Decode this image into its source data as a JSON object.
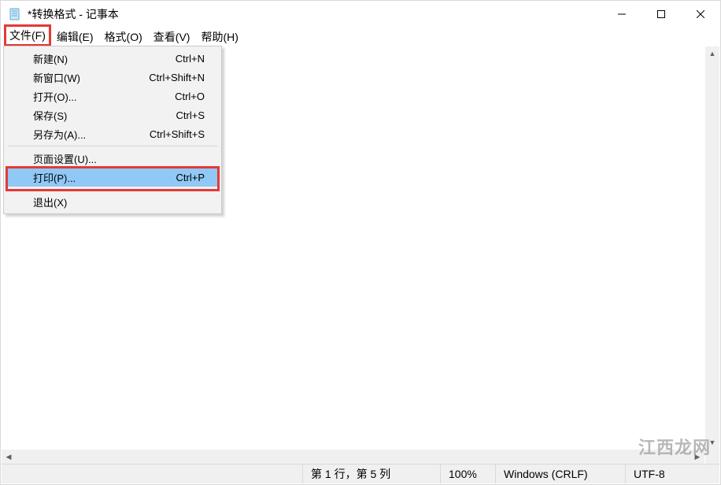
{
  "title": "*转换格式 - 记事本",
  "menubar": {
    "file": "文件(F)",
    "edit": "编辑(E)",
    "format": "格式(O)",
    "view": "查看(V)",
    "help": "帮助(H)"
  },
  "file_menu": {
    "new": {
      "label": "新建(N)",
      "shortcut": "Ctrl+N"
    },
    "new_window": {
      "label": "新窗口(W)",
      "shortcut": "Ctrl+Shift+N"
    },
    "open": {
      "label": "打开(O)...",
      "shortcut": "Ctrl+O"
    },
    "save": {
      "label": "保存(S)",
      "shortcut": "Ctrl+S"
    },
    "save_as": {
      "label": "另存为(A)...",
      "shortcut": "Ctrl+Shift+S"
    },
    "page_setup": {
      "label": "页面设置(U)...",
      "shortcut": ""
    },
    "print": {
      "label": "打印(P)...",
      "shortcut": "Ctrl+P"
    },
    "exit": {
      "label": "退出(X)",
      "shortcut": ""
    }
  },
  "status": {
    "position": "第 1 行，第 5 列",
    "zoom": "100%",
    "line_ending": "Windows (CRLF)",
    "encoding": "UTF-8"
  },
  "watermark": "江西龙网"
}
